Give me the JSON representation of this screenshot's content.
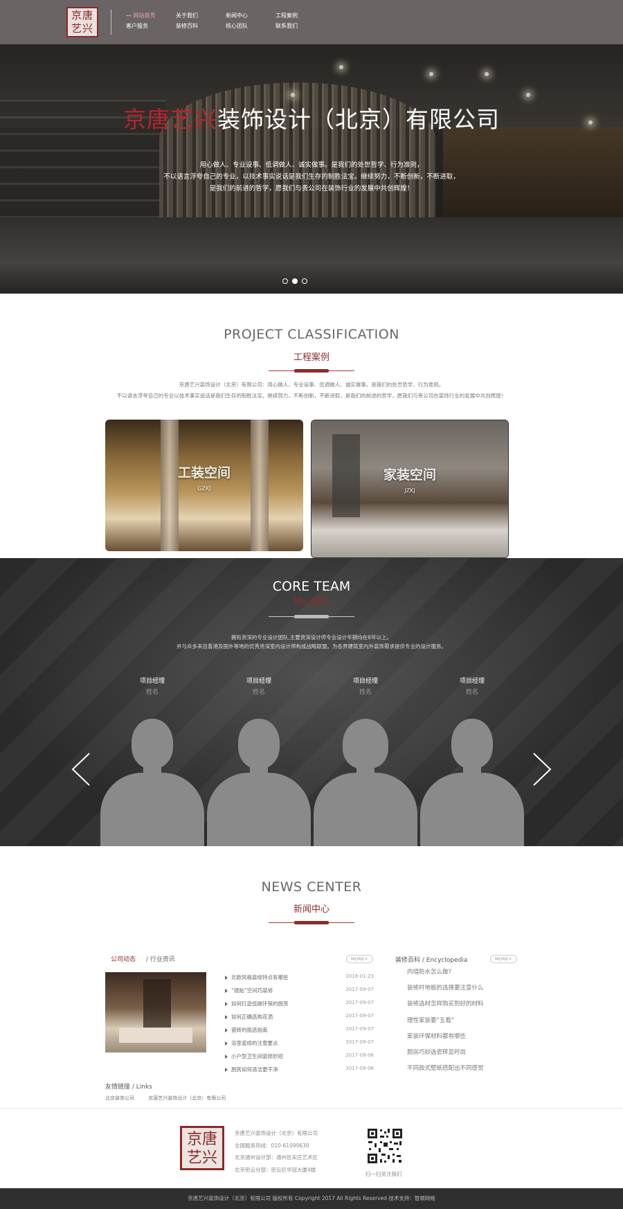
{
  "header": {
    "logo_text": [
      "京唐",
      "艺兴"
    ],
    "nav": [
      {
        "label": "网站首页",
        "active": true
      },
      {
        "label": "关于我们"
      },
      {
        "label": "新闻中心"
      },
      {
        "label": "工程案例"
      },
      {
        "label": "客户服务"
      },
      {
        "label": "装修百科"
      },
      {
        "label": "核心团队"
      },
      {
        "label": "联系我们"
      }
    ]
  },
  "hero": {
    "title_red": "京唐艺兴",
    "title_rest": "装饰设计（北京）有限公司",
    "lines": [
      "用心做人、专业设事、低调做人、诚实做事。是我们的处世哲学、行为准则，",
      "不以语言浮夸自己的专业，以技术事实说话是我们生存的制胜法宝。继续努力，不断创新，不断进取，",
      "是我们的前进的哲学，愿我们与贵公司在装饰行业的发展中共创辉煌！"
    ],
    "slides_total": 3,
    "slide_active": 2
  },
  "projects": {
    "title_en": "PROJECT CLASSIFICATION",
    "title_cn": "工程案例",
    "desc": [
      "京唐艺兴装饰设计（北京）有限公司：用心做人、专业设事、低调做人、诚实做事。是我们的处世哲学、行为准则。",
      "不以语言浮夸自己的专业以技术事实说话是我们生存的制胜法宝。继续努力，不断创新，不断进取，是我们的前进的哲学，愿我们与贵公司在装饰行业的发展中共创辉煌！"
    ],
    "cards": [
      {
        "title": "工装空间",
        "sub": "GZKJ"
      },
      {
        "title": "家装空间",
        "sub": "JZKJ"
      }
    ]
  },
  "team": {
    "title_en": "CORE TEAM",
    "title_cn": "核心团队",
    "desc": [
      "拥有资深的专业设计团队,主要资深设计师专业设计年期均在6年以上。",
      "并与众多来自香港及国外等地的优秀资深室内设计师构成战略联盟。为各界建筑室内外装饰需求提供专业的设计服务。"
    ],
    "members": [
      {
        "role": "项目经理",
        "name": "姓名"
      },
      {
        "role": "项目经理",
        "name": "姓名"
      },
      {
        "role": "项目经理",
        "name": "姓名"
      },
      {
        "role": "项目经理",
        "name": "姓名"
      }
    ]
  },
  "news": {
    "title_en": "NEWS CENTER",
    "title_cn": "新闻中心",
    "tab_active": "公司动态",
    "tab_other": "/ 行业资讯",
    "more": "MORE+",
    "items": [
      {
        "title": "北欧风格装修特点有哪些",
        "date": "2018-01-23"
      },
      {
        "title": "“镜贴”空间巧装修",
        "date": "2017-09-07"
      },
      {
        "title": "如何打造低碳环保的厨房",
        "date": "2017-09-07"
      },
      {
        "title": "如何正确选购花洒",
        "date": "2017-09-07"
      },
      {
        "title": "瓷砖的挑选指南",
        "date": "2017-09-07"
      },
      {
        "title": "浴室装修的注意要点",
        "date": "2017-09-07"
      },
      {
        "title": "小户型卫生间装修妙招",
        "date": "2017-09-06"
      },
      {
        "title": "厨房如何清洁更干净",
        "date": "2017-09-06"
      }
    ],
    "ency_title": "装修百科 / Encyclopedia",
    "ency_more": "MORE+",
    "ency_items": [
      "内墙防水怎么做?",
      "装修时地板的选择要注意什么",
      "装修选材怎样购买到好的材料",
      "理性家装要“五看”",
      "家装环保材料都有哪些",
      "厨房巧妙选瓷砖显时尚",
      "不同款式壁纸搭配出不同感觉"
    ],
    "links_title": "友情链接 / Links",
    "links": [
      "北京装饰公司",
      "京唐艺兴装饰设计（北京）有限公司"
    ]
  },
  "footer": {
    "logo_text": [
      "京唐",
      "艺兴"
    ],
    "info": [
      "京唐艺兴装饰设计（北京）有限公司",
      "全国服务热线：010-61099630",
      "北京通州设计部：通州区宋庄艺术区",
      "北京密云分部：密云区华冠大厦4楼"
    ],
    "qr_caption": "扫一扫关注我们",
    "copyright": "京唐艺兴装饰设计（北京）有限公司 版权所有 Copyright 2017 All Rights Reserved 技术支持：智顺网络"
  },
  "colors": {
    "brand_red": "#8b2d2d",
    "header_bg": "#6a6464",
    "footer_bg": "#2f2f2f"
  }
}
